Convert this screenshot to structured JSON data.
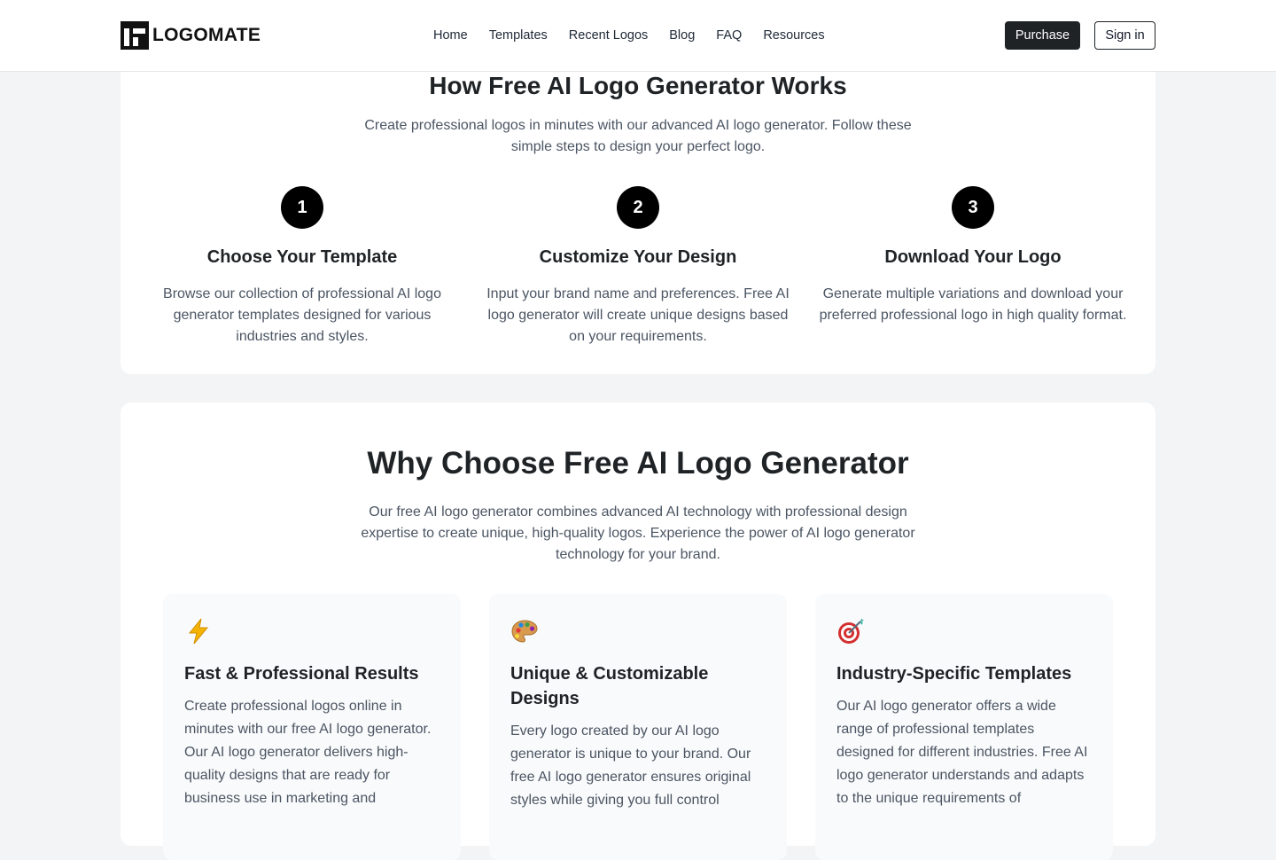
{
  "brand": {
    "name": "LOGOMATE"
  },
  "nav": {
    "items": [
      {
        "label": "Home"
      },
      {
        "label": "Templates"
      },
      {
        "label": "Recent Logos"
      },
      {
        "label": "Blog"
      },
      {
        "label": "FAQ"
      },
      {
        "label": "Resources"
      }
    ],
    "purchase_label": "Purchase",
    "signin_label": "Sign in"
  },
  "how_it_works": {
    "title": "How Free AI Logo Generator Works",
    "subtitle": "Create professional logos in minutes with our advanced AI logo generator. Follow these simple steps to design your perfect logo.",
    "steps": [
      {
        "number": "1",
        "title": "Choose Your Template",
        "description": "Browse our collection of professional AI logo generator templates designed for various industries and styles."
      },
      {
        "number": "2",
        "title": "Customize Your Design",
        "description": "Input your brand name and preferences. Free AI logo generator will create unique designs based on your requirements."
      },
      {
        "number": "3",
        "title": "Download Your Logo",
        "description": "Generate multiple variations and download your preferred professional logo in high quality format."
      }
    ]
  },
  "why_choose": {
    "title": "Why Choose Free AI Logo Generator",
    "subtitle": "Our free AI logo generator combines advanced AI technology with professional design expertise to create unique, high-quality logos. Experience the power of AI logo generator technology for your brand.",
    "features": [
      {
        "icon": "lightning-icon",
        "title": "Fast & Professional Results",
        "description": "Create professional logos online in minutes with our free AI logo generator. Our AI logo generator delivers high-quality designs that are ready for business use in marketing and"
      },
      {
        "icon": "palette-icon",
        "title": "Unique & Customizable Designs",
        "description": "Every logo created by our AI logo generator is unique to your brand. Our free AI logo generator ensures original styles while giving you full control"
      },
      {
        "icon": "target-icon",
        "title": "Industry-Specific Templates",
        "description": "Our AI logo generator offers a wide range of professional templates designed for different industries. Free AI logo generator understands and adapts to the unique requirements of"
      }
    ]
  },
  "colors": {
    "page_background": "#f3f4f6",
    "card_background": "#ffffff",
    "primary_dark": "#1f2326",
    "step_circle": "#000000",
    "text_muted": "#4b5563"
  }
}
